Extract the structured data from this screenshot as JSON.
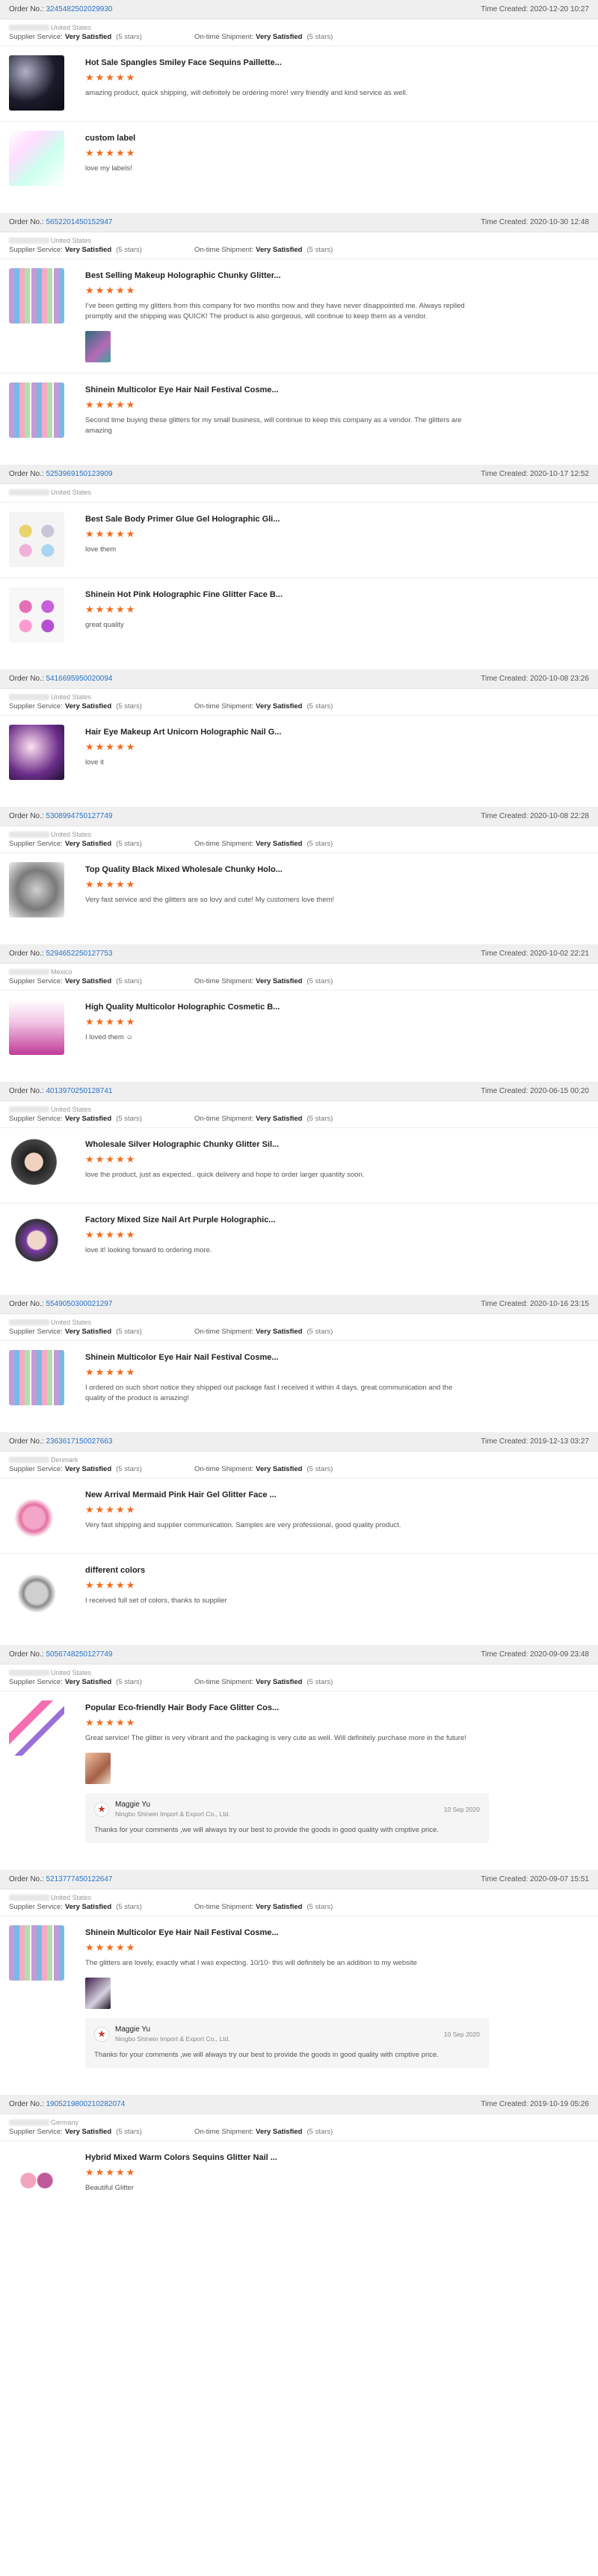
{
  "labels": {
    "order_no": "Order No.:",
    "time_created": "Time Created:",
    "supplier_service": "Supplier Service:",
    "ontime_shipment": "On-time Shipment:"
  },
  "orders": [
    {
      "order_no": "3245482502029930",
      "time": "2020-12-20 10:27",
      "country": "United States",
      "supplier_service": "Very Satisfied",
      "supplier_stars": "(5 stars)",
      "shipment": "Very Satisfied",
      "shipment_stars": "(5 stars)",
      "products": [
        {
          "title": "Hot Sale Spangles Smiley Face Sequins Paillette...",
          "text": "amazing product, quick shipping, will definitely be ordering more! very friendly and kind service as well.",
          "thumb": "bg-dark"
        },
        {
          "title": "custom label",
          "text": "love my labels!",
          "thumb": "bg-pastel"
        }
      ]
    },
    {
      "order_no": "5652201450152947",
      "time": "2020-10-30 12:48",
      "country": "United States",
      "supplier_service": "Very Satisfied",
      "supplier_stars": "(5 stars)",
      "shipment": "Very Satisfied",
      "shipment_stars": "(5 stars)",
      "products": [
        {
          "title": "Best Selling Makeup Holographic Chunky Glitter...",
          "text": "I've been getting my glitters from this company for two months now and they have never disappointed me. Always replied promptly and the shipping was QUICK! The product is also gorgeous, will continue to keep them as a vendor.",
          "thumb": "tubes",
          "photo": "photo-tile"
        },
        {
          "title": "Shinein Multicolor Eye Hair Nail Festival Cosme...",
          "text": "Second time buying these glitters for my small business, will continue to keep this company as a vendor. The glitters are amazing",
          "thumb": "tubes"
        }
      ]
    },
    {
      "order_no": "5253969150123909",
      "time": "2020-10-17 12:52",
      "country": "United States",
      "supplier_service": "",
      "supplier_stars": "",
      "shipment": "",
      "shipment_stars": "",
      "products": [
        {
          "title": "Best Sale Body Primer Glue Gel Holographic Gli...",
          "text": "love them",
          "thumb": "palette"
        },
        {
          "title": "Shinein Hot Pink Holographic Fine Glitter Face B...",
          "text": "great quality",
          "thumb": "palette-pink"
        }
      ]
    },
    {
      "order_no": "5416695950020094",
      "time": "2020-10-08 23:26",
      "country": "United States",
      "supplier_service": "Very Satisfied",
      "supplier_stars": "(5 stars)",
      "shipment": "Very Satisfied",
      "shipment_stars": "(5 stars)",
      "products": [
        {
          "title": "Hair Eye Makeup Art Unicorn Holographic Nail G...",
          "text": "love it",
          "thumb": "unicorn"
        }
      ]
    },
    {
      "order_no": "5308994750127749",
      "time": "2020-10-08 22:28",
      "country": "United States",
      "supplier_service": "Very Satisfied",
      "supplier_stars": "(5 stars)",
      "shipment": "Very Satisfied",
      "shipment_stars": "(5 stars)",
      "products": [
        {
          "title": "Top Quality Black Mixed Wholesale Chunky Holo...",
          "text": "Very fast service and the glitters are so lovy and cute! My customers love them!",
          "thumb": "silver"
        }
      ]
    },
    {
      "order_no": "5294652250127753",
      "time": "2020-10-02 22:21",
      "country": "Mexico",
      "supplier_service": "Very Satisfied",
      "supplier_stars": "(5 stars)",
      "shipment": "Very Satisfied",
      "shipment_stars": "(5 stars)",
      "products": [
        {
          "title": "High Quality Multicolor Holographic Cosmetic B...",
          "text": "I loved them ☺",
          "thumb": "bottle-pink"
        }
      ]
    },
    {
      "order_no": "4013970250128741",
      "time": "2020-06-15 00:20",
      "country": "United States",
      "supplier_service": "Very Satisfied",
      "supplier_stars": "(5 stars)",
      "shipment": "Very Satisfied",
      "shipment_stars": "(5 stars)",
      "products": [
        {
          "title": "Wholesale Silver Holographic Chunky Glitter Sil...",
          "text": "love the product, just as expected.. quick delivery and hope to order larger quantity soon.",
          "thumb": "face"
        },
        {
          "title": "Factory Mixed Size Nail Art Purple Holographic...",
          "text": "love it! looking forward to ordering more.",
          "thumb": "face-purple"
        }
      ]
    },
    {
      "order_no": "5549050300021297",
      "time": "2020-10-16 23:15",
      "country": "United States",
      "supplier_service": "Very Satisfied",
      "supplier_stars": "(5 stars)",
      "shipment": "Very Satisfied",
      "shipment_stars": "(5 stars)",
      "products": [
        {
          "title": "Shinein Multicolor Eye Hair Nail Festival Cosme...",
          "text": "I ordered on such short notice they shipped out package fast I received it within 4 days. great communication and the quality of the product is amazing!",
          "thumb": "tubes"
        }
      ]
    },
    {
      "order_no": "2363617150027663",
      "time": "2019-12-13 03:27",
      "country": "Denmark",
      "supplier_service": "Very Satisfied",
      "supplier_stars": "(5 stars)",
      "shipment": "Very Satisfied",
      "shipment_stars": "(5 stars)",
      "products": [
        {
          "title": "New Arrival Mermaid Pink Hair Gel Glitter Face ...",
          "text": "Very fast shipping and supplier communication. Samples are very professional, good quality product.",
          "thumb": "pink-pot"
        },
        {
          "title": "different colors",
          "text": "I received full set of colors, thanks to supplier",
          "thumb": "silver-pot"
        }
      ]
    },
    {
      "order_no": "5056748250127749",
      "time": "2020-09-09 23:48",
      "country": "United States",
      "supplier_service": "Very Satisfied",
      "supplier_stars": "(5 stars)",
      "shipment": "Very Satisfied",
      "shipment_stars": "(5 stars)",
      "products": [
        {
          "title": "Popular Eco-friendly Hair Body Face Glitter Cos...",
          "text": "Great service! The glitter is very vibrant and the packaging is very cute as well. Will definitely purchase more in the future!",
          "thumb": "hair",
          "photo": "photo-tile2",
          "reply": {
            "name": "Maggie Yu",
            "company": "Ningbo Shinein Import & Export Co., Ltd.",
            "date": "10 Sep 2020",
            "text": "Thanks for your comments ,we will always try our best to provide the goods in good quality with cmptive price."
          }
        }
      ]
    },
    {
      "order_no": "5213777450122647",
      "time": "2020-09-07 15:51",
      "country": "United States",
      "supplier_service": "Very Satisfied",
      "supplier_stars": "(5 stars)",
      "shipment": "Very Satisfied",
      "shipment_stars": "(5 stars)",
      "products": [
        {
          "title": "Shinein Multicolor Eye Hair Nail Festival Cosme...",
          "text": "The glitters are lovely, exactly what I was expecting. 10/10- this will definitely be an addition to my website",
          "thumb": "tubes",
          "photo": "photo-tile3",
          "reply": {
            "name": "Maggie Yu",
            "company": "Ningbo Shinein Import & Export Co., Ltd.",
            "date": "10 Sep 2020",
            "text": "Thanks for your comments ,we will always try our best to provide the goods in good quality with cmptive price."
          }
        }
      ]
    },
    {
      "order_no": "1905219800210282074",
      "time": "2019-10-19 05:26",
      "country": "Germany",
      "supplier_service": "Very Satisfied",
      "supplier_stars": "(5 stars)",
      "shipment": "Very Satisfied",
      "shipment_stars": "(5 stars)",
      "products": [
        {
          "title": "Hybrid Mixed Warm Colors Sequins Glitter Nail ...",
          "text": "Beautiful Glitter",
          "thumb": "warm"
        }
      ]
    }
  ],
  "stars_glyph": "★★★★★"
}
